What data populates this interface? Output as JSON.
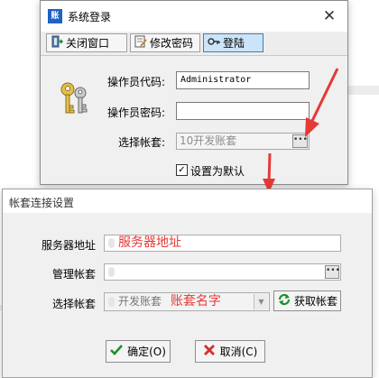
{
  "colors": {
    "accent": "#3c7fb1",
    "annotation_red": "#e53935",
    "window_bg": "#f0f0f0"
  },
  "login_dialog": {
    "title": "系统登录",
    "toolbar": {
      "close_label": "关闭窗口",
      "change_password_label": "修改密码",
      "login_label": "登陆"
    },
    "operator_code_label": "操作员代码:",
    "operator_code_value": "Administrator",
    "operator_password_label": "操作员密码:",
    "operator_password_value": "",
    "account_label": "选择帐套:",
    "account_value": "10开发账套",
    "set_default_label": "设置为默认",
    "set_default_checked": true
  },
  "account_dialog": {
    "title": "帐套连接设置",
    "server_address_label": "服务器地址",
    "server_address_annotation": "服务器地址",
    "manage_account_label": "管理帐套",
    "manage_account_value": "",
    "select_account_label": "选择帐套",
    "select_account_value": "开发账套",
    "select_account_annotation": "账套名字",
    "fetch_accounts_label": "获取帐套",
    "confirm_label": "确定(O)",
    "cancel_label": "取消(C)"
  },
  "icons": [
    "app-icon",
    "close-icon",
    "exit-door-icon",
    "edit-password-icon",
    "key-icon",
    "keys-icon",
    "ellipsis-icon",
    "checkbox-check-icon",
    "chevron-down-icon",
    "refresh-icon",
    "checkmark-icon",
    "x-icon"
  ]
}
